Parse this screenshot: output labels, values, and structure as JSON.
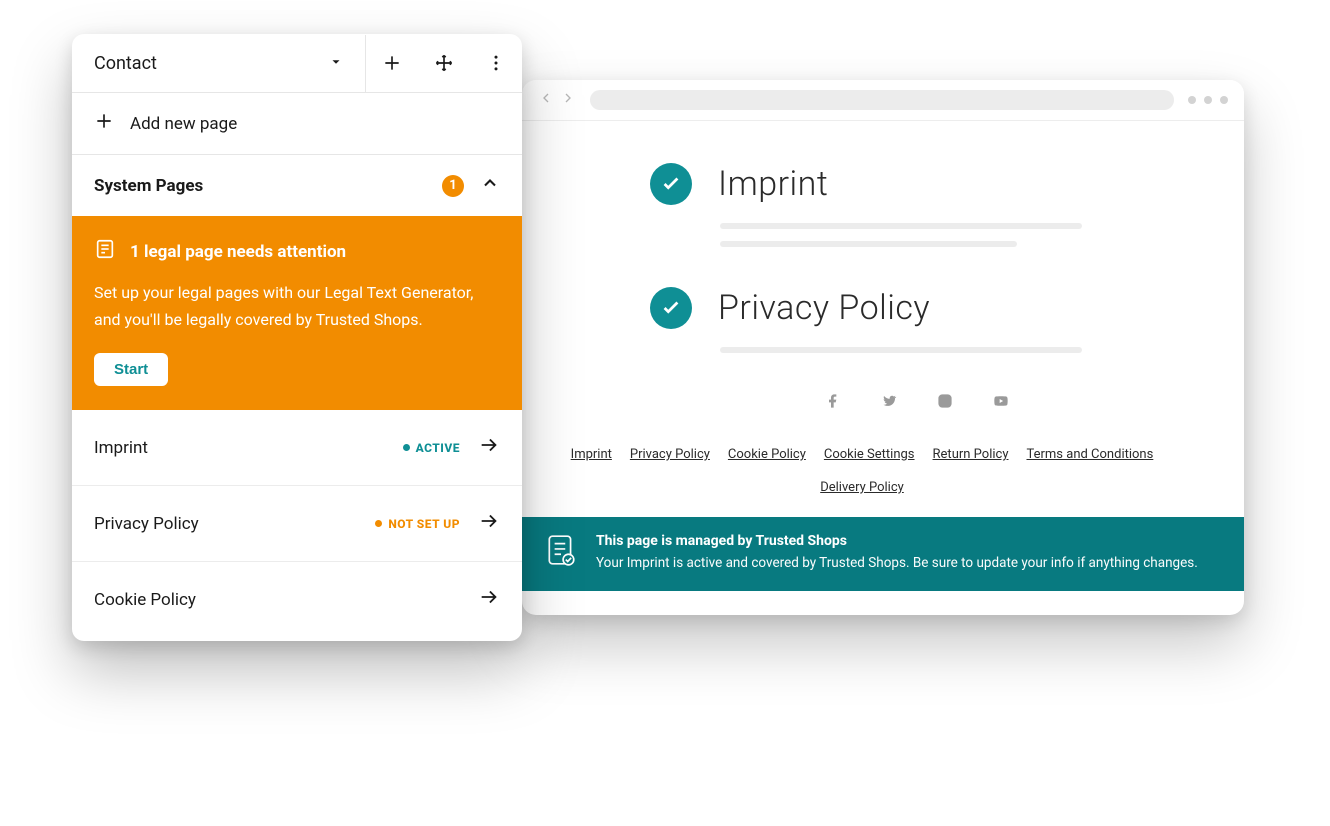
{
  "colors": {
    "teal": "#0f8f95",
    "orange": "#f28c00",
    "teal_dark": "#087a80"
  },
  "panel": {
    "page_select_label": "Contact",
    "add_page_label": "Add new page",
    "section_label": "System Pages",
    "badge_count": "1",
    "alert": {
      "title": "1 legal page needs attention",
      "description": "Set up your legal pages with our Legal Text Generator, and you'll be legally covered by Trusted Shops.",
      "button": "Start"
    },
    "pages": [
      {
        "name": "Imprint",
        "status_label": "ACTIVE",
        "status_key": "active"
      },
      {
        "name": "Privacy Policy",
        "status_label": "NOT SET UP",
        "status_key": "notset"
      },
      {
        "name": "Cookie Policy",
        "status_label": "",
        "status_key": ""
      }
    ]
  },
  "preview": {
    "sections": [
      {
        "title": "Imprint"
      },
      {
        "title": "Privacy Policy"
      }
    ],
    "social": [
      "facebook",
      "twitter",
      "instagram",
      "youtube"
    ],
    "footer_links": [
      "Imprint",
      "Privacy Policy",
      "Cookie Policy",
      "Cookie Settings",
      "Return Policy",
      "Terms and Conditions",
      "Delivery Policy"
    ],
    "trusted_banner": {
      "title": "This page is managed by Trusted Shops",
      "description": "Your Imprint is active and covered by Trusted Shops. Be sure to update your info if anything changes."
    }
  }
}
